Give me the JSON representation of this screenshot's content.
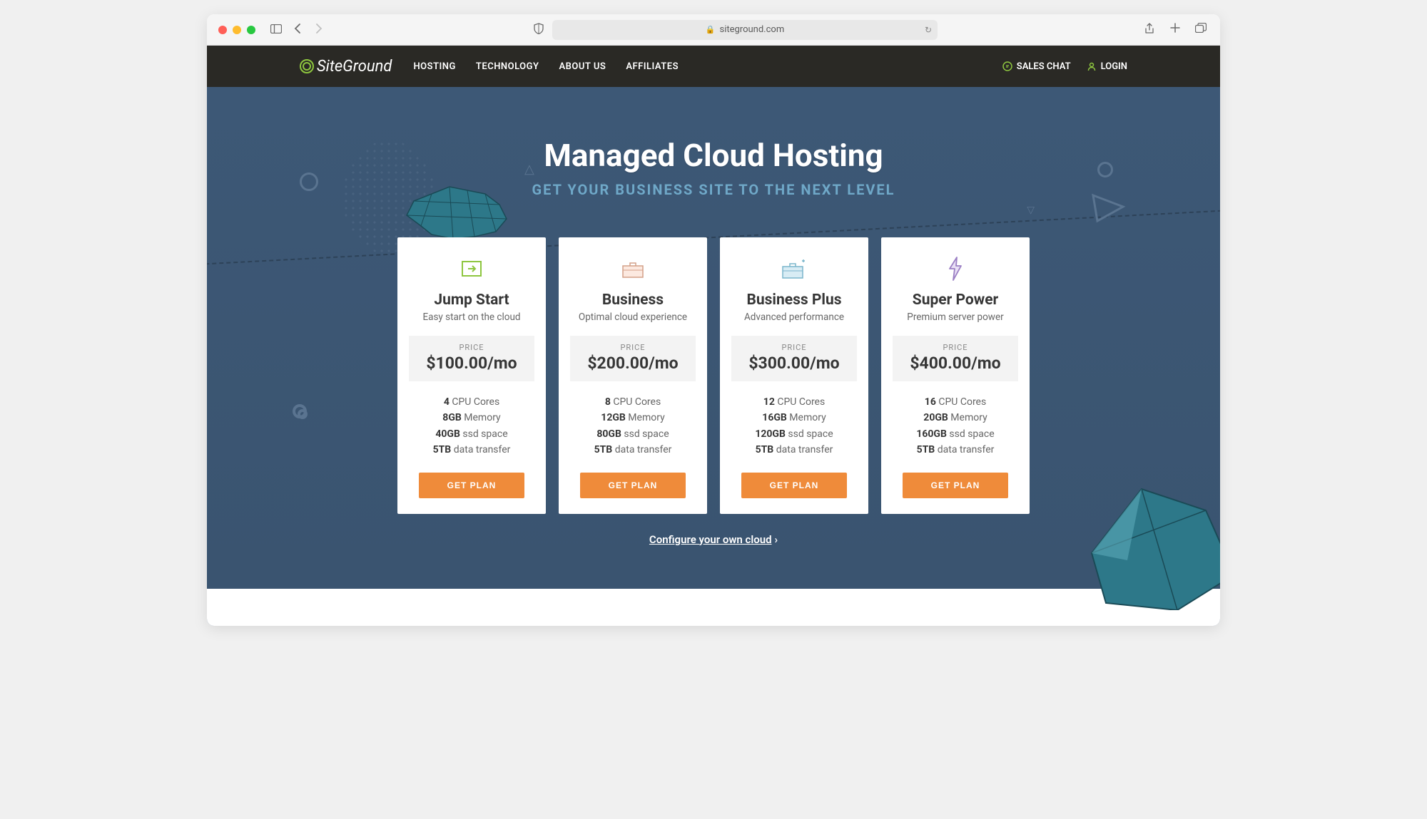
{
  "browser": {
    "url": "siteground.com"
  },
  "nav": {
    "brand": "SiteGround",
    "links": [
      "HOSTING",
      "TECHNOLOGY",
      "ABOUT US",
      "AFFILIATES"
    ],
    "sales_chat": "SALES CHAT",
    "login": "LOGIN"
  },
  "hero": {
    "title": "Managed Cloud Hosting",
    "subtitle": "GET YOUR BUSINESS SITE TO THE NEXT LEVEL"
  },
  "price_label": "PRICE",
  "get_plan_label": "GET PLAN",
  "plans": [
    {
      "name": "Jump Start",
      "tagline": "Easy start on the cloud",
      "price": "$100.00/mo",
      "specs": [
        {
          "bold": "4",
          "text": " CPU Cores"
        },
        {
          "bold": "8GB",
          "text": " Memory"
        },
        {
          "bold": "40GB",
          "text": " ssd space"
        },
        {
          "bold": "5TB",
          "text": " data transfer"
        }
      ]
    },
    {
      "name": "Business",
      "tagline": "Optimal cloud experience",
      "price": "$200.00/mo",
      "specs": [
        {
          "bold": "8",
          "text": " CPU Cores"
        },
        {
          "bold": "12GB",
          "text": " Memory"
        },
        {
          "bold": "80GB",
          "text": " ssd space"
        },
        {
          "bold": "5TB",
          "text": " data transfer"
        }
      ]
    },
    {
      "name": "Business Plus",
      "tagline": "Advanced performance",
      "price": "$300.00/mo",
      "specs": [
        {
          "bold": "12",
          "text": " CPU Cores"
        },
        {
          "bold": "16GB",
          "text": " Memory"
        },
        {
          "bold": "120GB",
          "text": " ssd space"
        },
        {
          "bold": "5TB",
          "text": " data transfer"
        }
      ]
    },
    {
      "name": "Super Power",
      "tagline": "Premium server power",
      "price": "$400.00/mo",
      "specs": [
        {
          "bold": "16",
          "text": " CPU Cores"
        },
        {
          "bold": "20GB",
          "text": " Memory"
        },
        {
          "bold": "160GB",
          "text": " ssd space"
        },
        {
          "bold": "5TB",
          "text": " data transfer"
        }
      ]
    }
  ],
  "configure_link": "Configure your own cloud"
}
